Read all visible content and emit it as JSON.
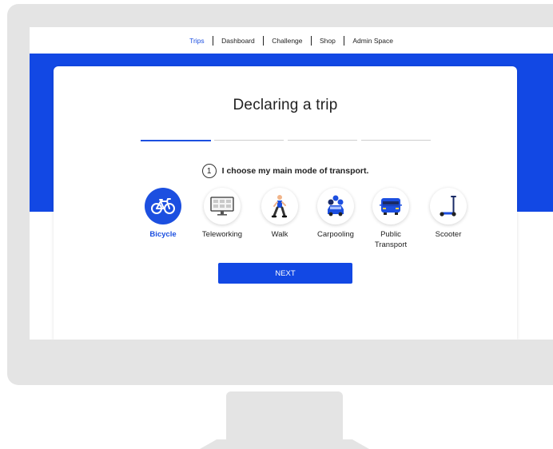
{
  "nav": {
    "items": [
      {
        "label": "Trips",
        "active": true
      },
      {
        "label": "Dashboard",
        "active": false
      },
      {
        "label": "Challenge",
        "active": false
      },
      {
        "label": "Shop",
        "active": false
      },
      {
        "label": "Admin Space",
        "active": false
      }
    ]
  },
  "page": {
    "title": "Declaring a trip",
    "progress": {
      "total_steps": 4,
      "current_step": 1
    }
  },
  "question": {
    "number": "1",
    "text": "I choose my main mode of transport."
  },
  "modes": [
    {
      "label": "Bicycle",
      "icon": "bicycle-icon",
      "selected": true
    },
    {
      "label": "Teleworking",
      "icon": "monitor-icon",
      "selected": false
    },
    {
      "label": "Walk",
      "icon": "walking-person-icon",
      "selected": false
    },
    {
      "label": "Carpooling",
      "icon": "carpool-icon",
      "selected": false
    },
    {
      "label": "Public\nTransport",
      "icon": "bus-icon",
      "selected": false
    },
    {
      "label": "Scooter",
      "icon": "scooter-icon",
      "selected": false
    }
  ],
  "next_button": {
    "label": "NEXT"
  },
  "colors": {
    "accent": "#1c4fe0",
    "band": "#1248e4",
    "frame": "#e4e4e4"
  }
}
